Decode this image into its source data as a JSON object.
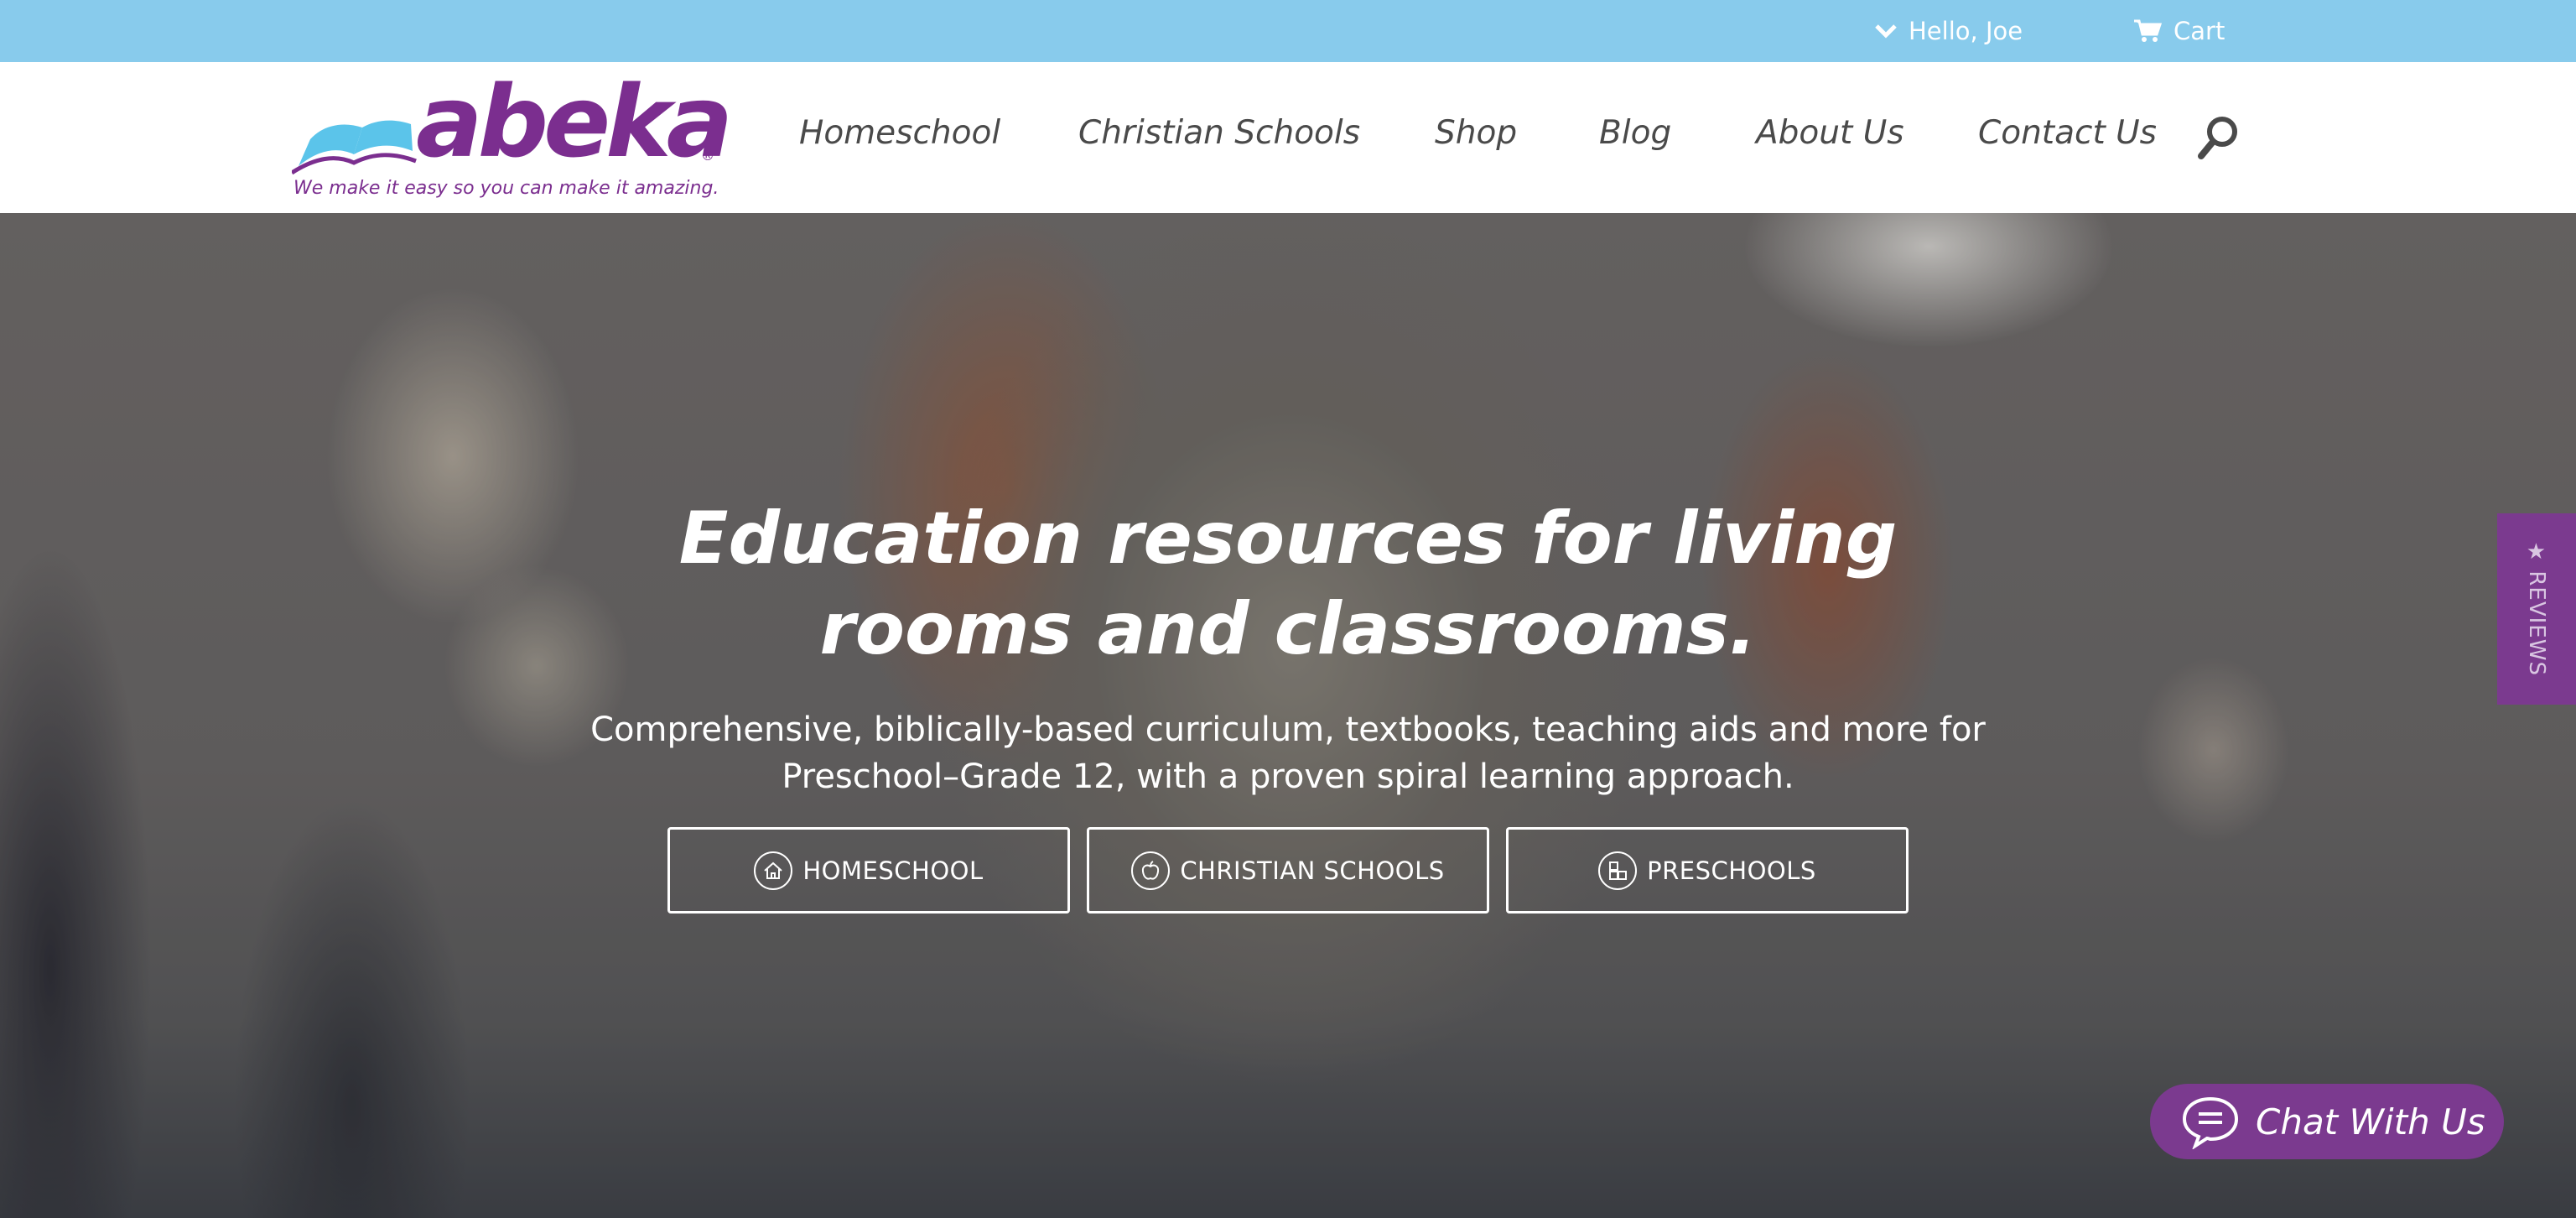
{
  "utility": {
    "account_label": "Hello, Joe",
    "cart_label": "Cart"
  },
  "brand": {
    "logo_text": "abeka",
    "registered_mark": "®",
    "tagline": "We make it easy so you can make it amazing.",
    "primary_color": "#7b2e8f",
    "accent_color": "#5bc4ea",
    "utility_bar_color": "#88cbec"
  },
  "nav": {
    "items": [
      {
        "label": "Homeschool"
      },
      {
        "label": "Christian Schools"
      },
      {
        "label": "Shop"
      },
      {
        "label": "Blog"
      },
      {
        "label": "About Us"
      },
      {
        "label": "Contact Us"
      }
    ],
    "search_icon": "search-icon"
  },
  "hero": {
    "title_line1": "Education resources for living",
    "title_line2": "rooms and classrooms.",
    "subtitle_line1": "Comprehensive, biblically-based curriculum, textbooks, teaching aids and more for",
    "subtitle_line2": "Preschool–Grade 12, with a proven spiral learning approach.",
    "buttons": [
      {
        "label": "HOMESCHOOL",
        "icon": "house-icon"
      },
      {
        "label": "CHRISTIAN SCHOOLS",
        "icon": "apple-icon"
      },
      {
        "label": "PRESCHOOLS",
        "icon": "blocks-icon"
      }
    ]
  },
  "reviews_tab": {
    "star": "★",
    "label": "REVIEWS"
  },
  "chat": {
    "label": "Chat With Us"
  }
}
